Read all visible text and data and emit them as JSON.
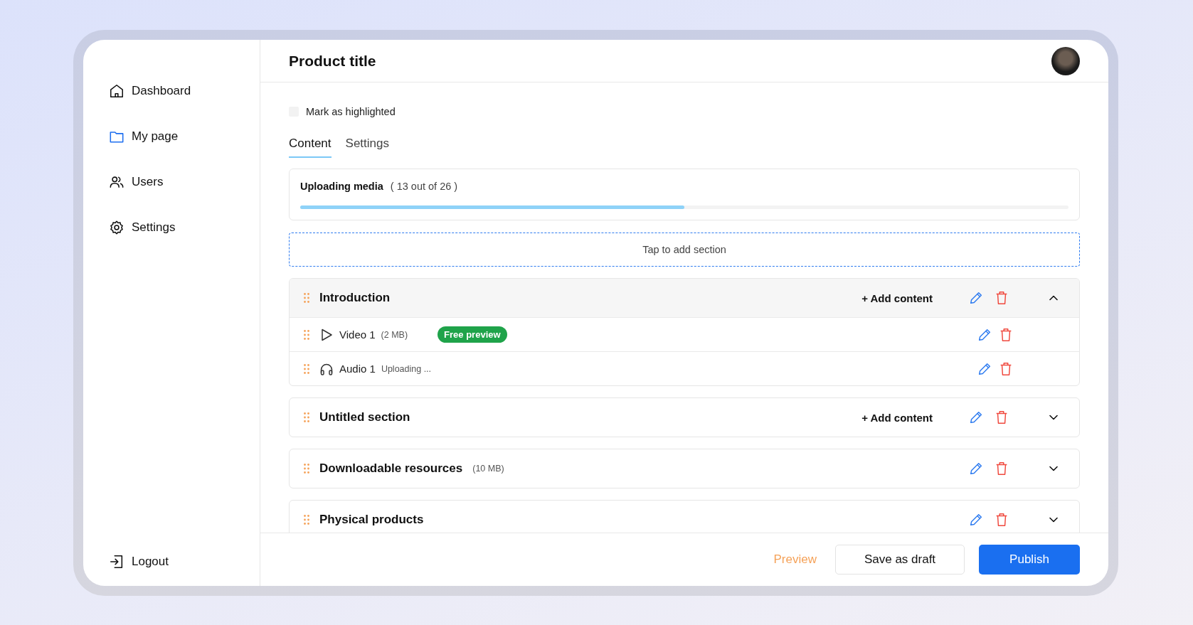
{
  "sidebar": {
    "items": [
      {
        "label": "Dashboard",
        "kind": "home",
        "selected": false
      },
      {
        "label": "My page",
        "kind": "folder",
        "selected": true
      },
      {
        "label": "Users",
        "kind": "users",
        "selected": false
      },
      {
        "label": "Settings",
        "kind": "gear",
        "selected": false
      }
    ],
    "logout": {
      "label": "Logout"
    }
  },
  "header": {
    "title": "Product title"
  },
  "highlight": {
    "label": "Mark as highlighted",
    "checked": false
  },
  "tabs": [
    {
      "label": "Content",
      "selected": true
    },
    {
      "label": "Settings",
      "selected": false
    }
  ],
  "upload": {
    "title": "Uploading media",
    "count": "( 13 out of 26 )",
    "level": 0.5
  },
  "add_section": {
    "label": "Tap to add section"
  },
  "sections": [
    {
      "title": "Introduction",
      "add_content": "+ Add content",
      "expanded": true,
      "items": [
        {
          "kind": "video",
          "name": "Video 1",
          "size": "(2 MB)",
          "badge": "Free preview"
        },
        {
          "kind": "audio",
          "name": "Audio 1",
          "status": "Uploading ..."
        }
      ]
    },
    {
      "title": "Untitled section",
      "add_content": "+ Add content",
      "expanded": false
    },
    {
      "title": "Downloadable resources",
      "size": "(10 MB)",
      "expanded": false
    },
    {
      "title": "Physical products",
      "expanded": false
    }
  ],
  "footer": {
    "preview": "Preview",
    "draft": "Save as draft",
    "publish": "Publish"
  }
}
